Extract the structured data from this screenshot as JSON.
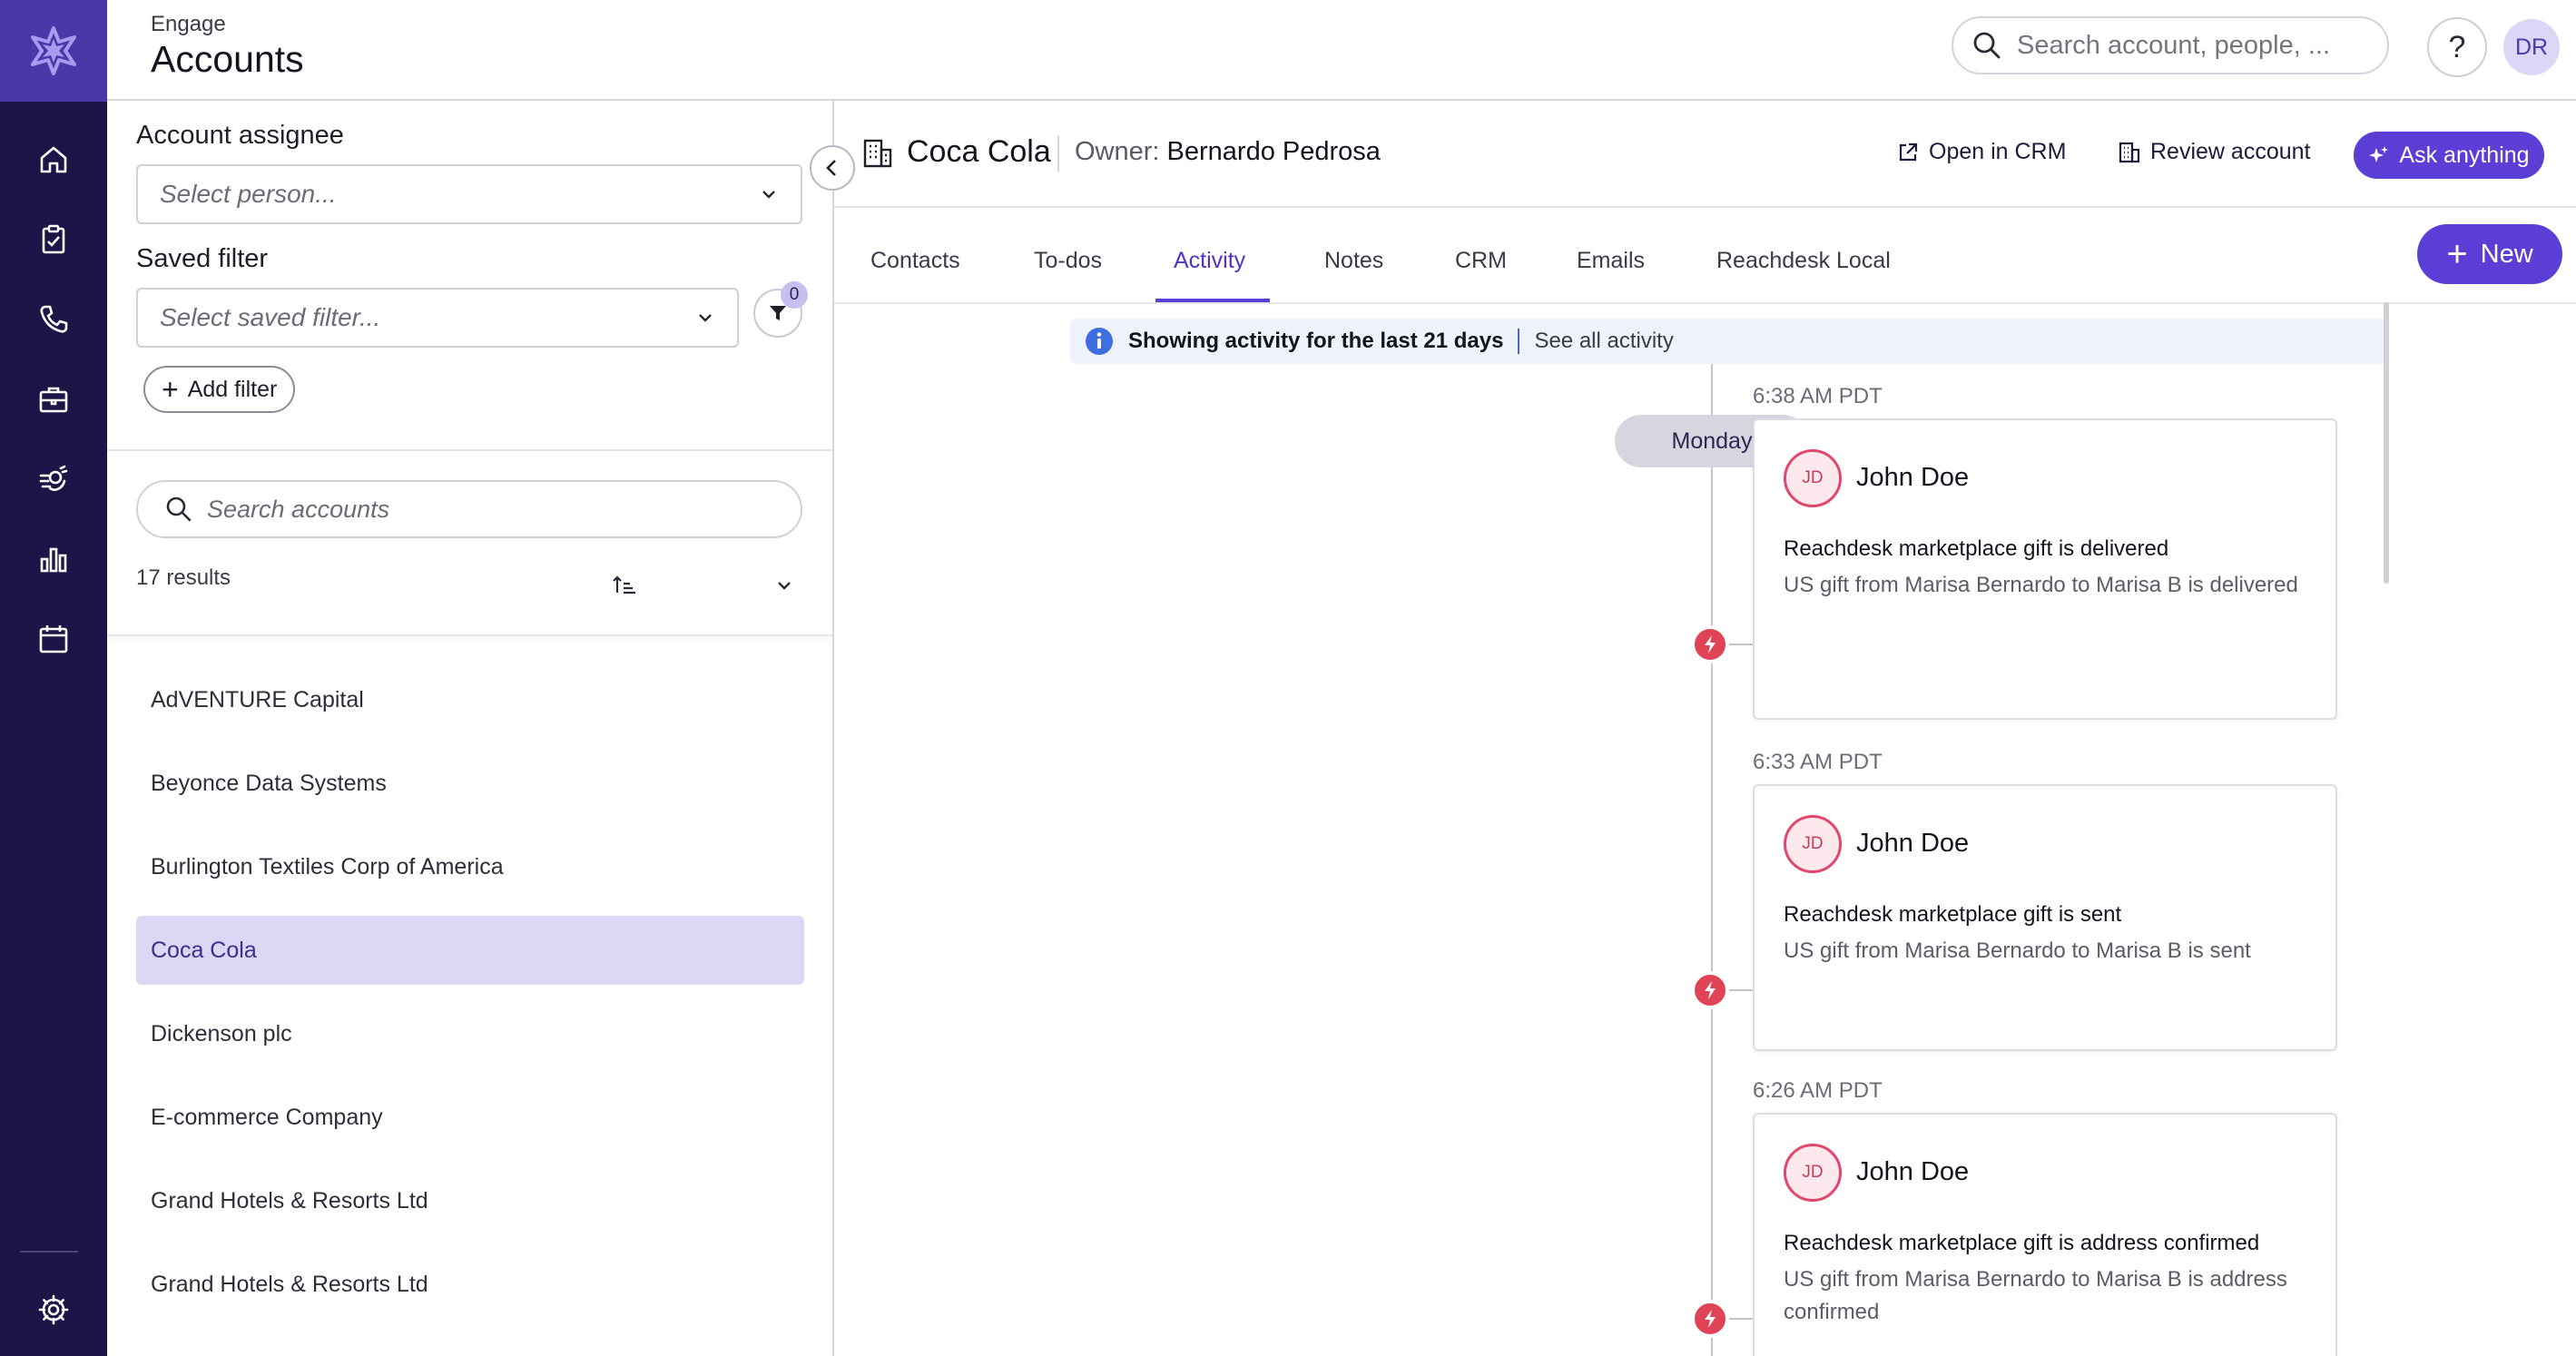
{
  "header": {
    "eyebrow": "Engage",
    "title": "Accounts",
    "search_placeholder": "Search account, people, ...",
    "help_label": "?",
    "user_initials": "DR"
  },
  "nav": {
    "items": [
      "home-icon",
      "clipboard-icon",
      "phone-icon",
      "briefcase-icon",
      "rocket-icon",
      "bar-chart-icon",
      "calendar-icon"
    ],
    "settings_icon": "gear-icon"
  },
  "filters": {
    "assignee_label": "Account assignee",
    "assignee_placeholder": "Select person...",
    "saved_filter_label": "Saved filter",
    "saved_filter_placeholder": "Select saved filter...",
    "filter_count": "0",
    "add_filter_label": "Add filter"
  },
  "account_search": {
    "placeholder": "Search accounts",
    "results": "17 results"
  },
  "accounts": [
    {
      "name": "AdVENTURE Capital",
      "selected": false
    },
    {
      "name": "Beyonce Data Systems",
      "selected": false
    },
    {
      "name": "Burlington Textiles Corp of America",
      "selected": false
    },
    {
      "name": "Coca Cola",
      "selected": true
    },
    {
      "name": "Dickenson plc",
      "selected": false
    },
    {
      "name": "E-commerce Company",
      "selected": false
    },
    {
      "name": "Grand Hotels & Resorts Ltd",
      "selected": false
    },
    {
      "name": "Grand Hotels & Resorts Ltd",
      "selected": false
    }
  ],
  "detail": {
    "account_name": "Coca Cola",
    "owner_label": "Owner:",
    "owner_name": "Bernardo Pedrosa",
    "open_crm": "Open in CRM",
    "review_account": "Review account",
    "ask_anything": "Ask anything",
    "new_label": "New",
    "tabs": [
      "Contacts",
      "To-dos",
      "Activity",
      "Notes",
      "CRM",
      "Emails",
      "Reachdesk Local"
    ],
    "active_tab": "Activity"
  },
  "activity": {
    "banner_text": "Showing activity for the last 21 days",
    "banner_link": "See all activity",
    "day": "Monday",
    "events": [
      {
        "time": "6:38 AM PDT",
        "initials": "JD",
        "person": "John Doe",
        "title": "Reachdesk marketplace gift is delivered",
        "description": "US gift from Marisa Bernardo to Marisa B is delivered"
      },
      {
        "time": "6:33 AM PDT",
        "initials": "JD",
        "person": "John Doe",
        "title": "Reachdesk marketplace gift is sent",
        "description": "US gift from Marisa Bernardo to Marisa B is sent"
      },
      {
        "time": "6:26 AM PDT",
        "initials": "JD",
        "person": "John Doe",
        "title": "Reachdesk marketplace gift is address confirmed",
        "description": "US gift from Marisa Bernardo to Marisa B is address confirmed"
      }
    ]
  },
  "colors": {
    "rail": "#1d1547",
    "brand": "#5b3ed6",
    "selected_row": "#ddd6f4",
    "event_icon": "#e04356"
  }
}
